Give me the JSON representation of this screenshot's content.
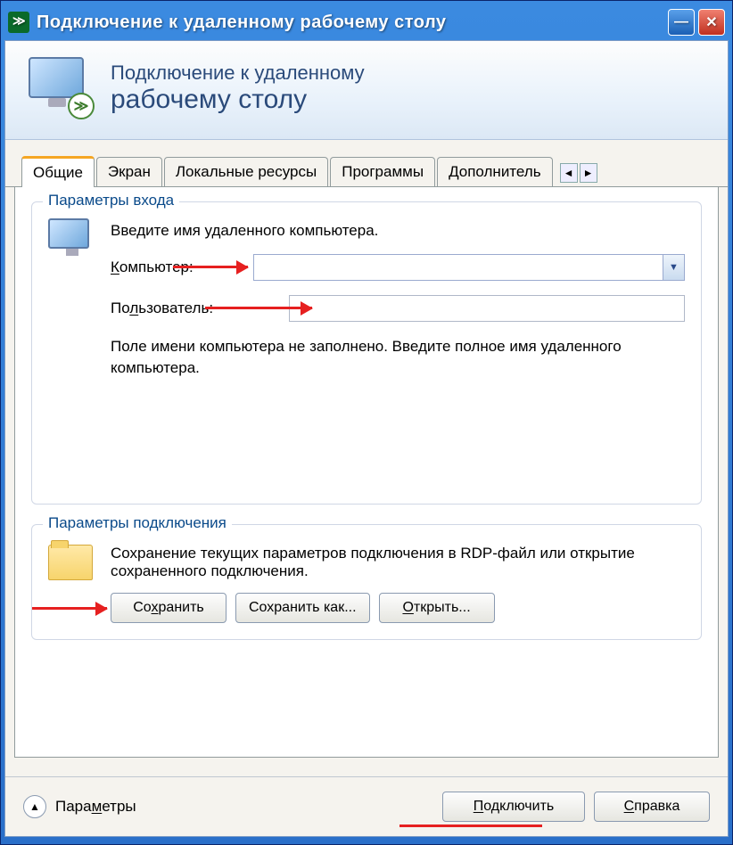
{
  "window": {
    "title": "Подключение к удаленному рабочему столу"
  },
  "hero": {
    "line1": "Подключение к удаленному",
    "line2": "рабочему столу"
  },
  "tabs": {
    "items": [
      "Общие",
      "Экран",
      "Локальные ресурсы",
      "Программы",
      "Дополнитель"
    ],
    "active_index": 0
  },
  "group_login": {
    "title": "Параметры входа",
    "instruction": "Введите имя удаленного компьютера.",
    "computer_label": "Компьютер:",
    "computer_value": "",
    "user_label": "Пользователь:",
    "user_value": "",
    "hint": "Поле имени компьютера не заполнено. Введите полное имя удаленного компьютера."
  },
  "group_conn": {
    "title": "Параметры подключения",
    "desc": "Сохранение текущих параметров подключения в RDP-файл или открытие сохраненного подключения.",
    "save": "Сохранить",
    "save_as": "Сохранить как...",
    "open": "Открыть..."
  },
  "bottom": {
    "options": "Параметры",
    "connect": "Подключить",
    "help": "Справка"
  }
}
